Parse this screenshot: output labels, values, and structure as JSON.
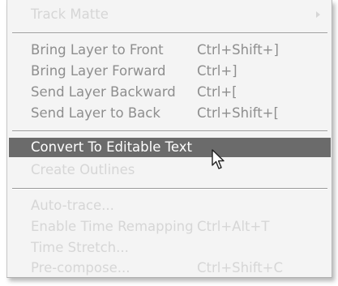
{
  "menu": {
    "items": [
      {
        "label": "Track Matte",
        "shortcut": ""
      },
      {
        "label": "Bring Layer to Front",
        "shortcut": "Ctrl+Shift+]"
      },
      {
        "label": "Bring Layer Forward",
        "shortcut": "Ctrl+]"
      },
      {
        "label": "Send Layer Backward",
        "shortcut": "Ctrl+["
      },
      {
        "label": "Send Layer to Back",
        "shortcut": "Ctrl+Shift+["
      },
      {
        "label": "Convert To Editable Text",
        "shortcut": ""
      },
      {
        "label": "Create Outlines",
        "shortcut": ""
      },
      {
        "label": "Auto-trace...",
        "shortcut": ""
      },
      {
        "label": "Enable Time Remapping",
        "shortcut": "Ctrl+Alt+T"
      },
      {
        "label": "Time Stretch...",
        "shortcut": ""
      },
      {
        "label": "Pre-compose...",
        "shortcut": "Ctrl+Shift+C"
      }
    ]
  },
  "icons": {
    "submenu": "chevron-right-icon",
    "pointer": "mouse-pointer-icon"
  },
  "colors": {
    "menu_background": "#f4f4f4",
    "enabled_text": "#8e8e8e",
    "faded_text": "#d6d6d6",
    "highlight_background": "#6b6b6b",
    "highlight_text": "#ffffff"
  }
}
